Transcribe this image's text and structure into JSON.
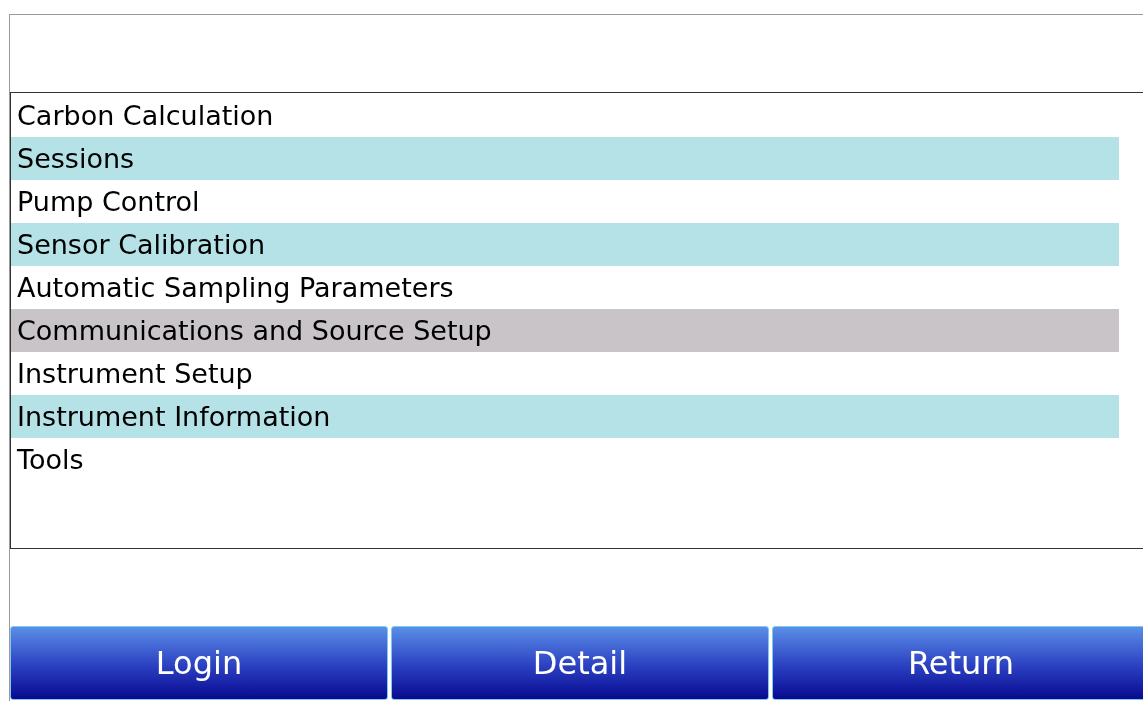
{
  "menu": {
    "items": [
      {
        "label": "Carbon Calculation",
        "selected": false
      },
      {
        "label": "Sessions",
        "selected": false
      },
      {
        "label": "Pump Control",
        "selected": false
      },
      {
        "label": "Sensor Calibration",
        "selected": false
      },
      {
        "label": "Automatic Sampling Parameters",
        "selected": false
      },
      {
        "label": "Communications and Source Setup",
        "selected": true
      },
      {
        "label": "Instrument Setup",
        "selected": false
      },
      {
        "label": "Instrument Information",
        "selected": false
      },
      {
        "label": "Tools",
        "selected": false
      }
    ]
  },
  "buttons": [
    "Login",
    "Detail",
    "Return"
  ]
}
